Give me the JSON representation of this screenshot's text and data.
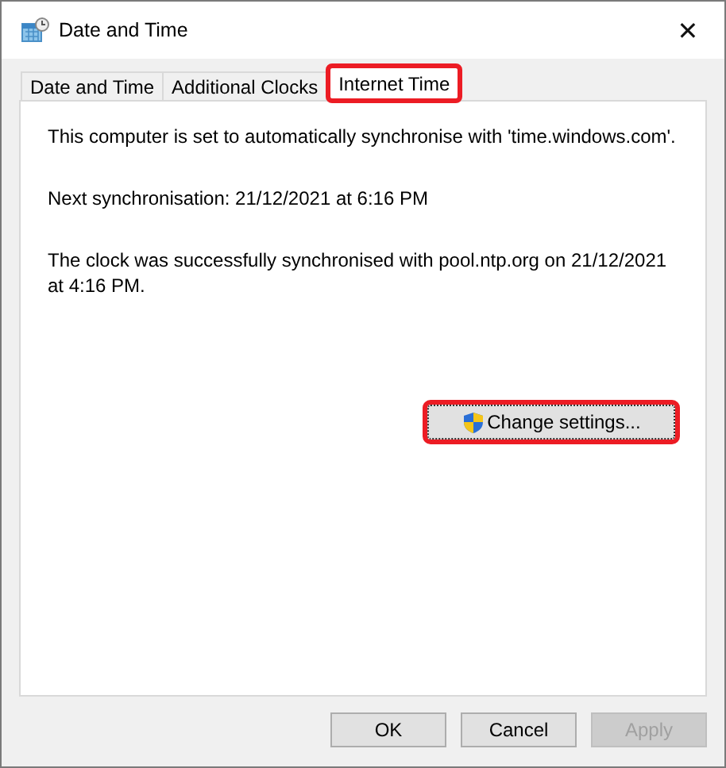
{
  "window": {
    "title": "Date and Time",
    "close": "✕"
  },
  "tabs": [
    {
      "label": "Date and Time",
      "selected": false,
      "highlighted": false
    },
    {
      "label": "Additional Clocks",
      "selected": false,
      "highlighted": false
    },
    {
      "label": "Internet Time",
      "selected": true,
      "highlighted": true
    }
  ],
  "panel": {
    "paragraphs": [
      "This computer is set to automatically synchronise with 'time.windows.com'.",
      "Next synchronisation: 21/12/2021 at 6:16 PM",
      "The clock was successfully synchronised with pool.ntp.org on 21/12/2021 at 4:16 PM."
    ],
    "change_button": {
      "label": "Change settings...",
      "highlighted": true
    }
  },
  "buttons": [
    {
      "label": "OK",
      "disabled": false
    },
    {
      "label": "Cancel",
      "disabled": false
    },
    {
      "label": "Apply",
      "disabled": true
    }
  ]
}
